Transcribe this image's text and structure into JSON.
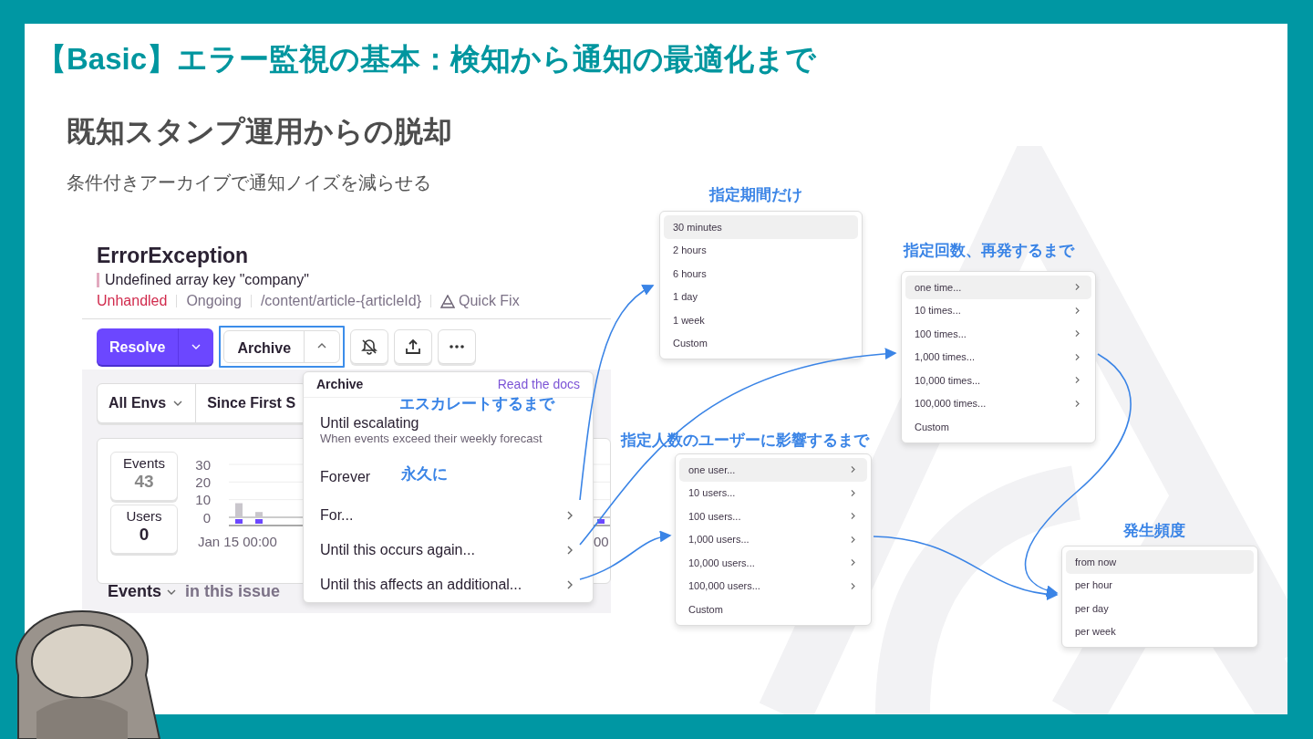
{
  "slide": {
    "title": "【Basic】エラー監視の基本：検知から通知の最適化まで",
    "heading": "既知スタンプ運用からの脱却",
    "subtitle": "条件付きアーカイブで通知ノイズを減らせる"
  },
  "issue": {
    "title": "ErrorException",
    "message": "Undefined array key \"company\"",
    "tags": [
      {
        "text": "Unhandled",
        "kind": "alert"
      },
      {
        "text": "Ongoing",
        "kind": "plain"
      },
      {
        "text": "/content/article-{articleId}",
        "kind": "plain"
      },
      {
        "text": "Quick Fix",
        "kind": "quick-fix"
      }
    ],
    "resolve_button": "Resolve",
    "archive_button": "Archive",
    "filters": [
      "All Envs",
      "Since First S"
    ],
    "stats": [
      {
        "label": "Events",
        "value": "43"
      },
      {
        "label": "Users",
        "value": "0"
      }
    ],
    "chart_data": {
      "type": "bar",
      "categories": [
        null,
        null,
        null,
        null,
        null,
        null,
        null,
        null,
        null,
        null,
        null,
        null,
        null,
        null,
        null,
        null,
        null,
        null,
        null
      ],
      "values": [
        8,
        3,
        0,
        0,
        0,
        0,
        0,
        0,
        0,
        0,
        0,
        0,
        0,
        0,
        0,
        0,
        0,
        0,
        0
      ],
      "ylim": [
        0,
        30
      ],
      "yticks": [
        0,
        10,
        20,
        30
      ]
    },
    "chart_x_labels": [
      "Jan 15 00:00",
      "00"
    ],
    "events_tab": "Events",
    "events_suffix": "in this issue"
  },
  "archive_menu": {
    "title": "Archive",
    "link": "Read the docs",
    "items": [
      {
        "label": "Until escalating",
        "description": "When events exceed their weekly forecast",
        "submenu": false
      },
      {
        "label": "Forever",
        "submenu": false
      },
      {
        "label": "For...",
        "submenu": true
      },
      {
        "label": "Until this occurs again...",
        "submenu": true
      },
      {
        "label": "Until this affects an additional...",
        "submenu": true
      }
    ]
  },
  "submenus": [
    {
      "items": [
        {
          "label": "30 minutes",
          "selected": true,
          "submenu": false
        },
        {
          "label": "2 hours",
          "selected": false,
          "submenu": false
        },
        {
          "label": "6 hours",
          "selected": false,
          "submenu": false
        },
        {
          "label": "1 day",
          "selected": false,
          "submenu": false
        },
        {
          "label": "1 week",
          "selected": false,
          "submenu": false
        },
        {
          "label": "Custom",
          "selected": false,
          "submenu": false
        }
      ]
    },
    {
      "items": [
        {
          "label": "one time...",
          "selected": true,
          "submenu": true
        },
        {
          "label": "10 times...",
          "selected": false,
          "submenu": true
        },
        {
          "label": "100 times...",
          "selected": false,
          "submenu": true
        },
        {
          "label": "1,000 times...",
          "selected": false,
          "submenu": true
        },
        {
          "label": "10,000 times...",
          "selected": false,
          "submenu": true
        },
        {
          "label": "100,000 times...",
          "selected": false,
          "submenu": true
        },
        {
          "label": "Custom",
          "selected": false,
          "submenu": false
        }
      ]
    },
    {
      "items": [
        {
          "label": "one user...",
          "selected": true,
          "submenu": true
        },
        {
          "label": "10 users...",
          "selected": false,
          "submenu": true
        },
        {
          "label": "100 users...",
          "selected": false,
          "submenu": true
        },
        {
          "label": "1,000 users...",
          "selected": false,
          "submenu": true
        },
        {
          "label": "10,000 users...",
          "selected": false,
          "submenu": true
        },
        {
          "label": "100,000 users...",
          "selected": false,
          "submenu": true
        },
        {
          "label": "Custom",
          "selected": false,
          "submenu": false
        }
      ]
    },
    {
      "items": [
        {
          "label": "from now",
          "selected": true,
          "submenu": false
        },
        {
          "label": "per hour",
          "selected": false,
          "submenu": false
        },
        {
          "label": "per day",
          "selected": false,
          "submenu": false
        },
        {
          "label": "per week",
          "selected": false,
          "submenu": false
        }
      ]
    }
  ],
  "annotations": [
    "エスカレートするまで",
    "永久に",
    "指定期間だけ",
    "指定回数、再発するまで",
    "指定人数のユーザーに影響するまで",
    "発生頻度"
  ]
}
